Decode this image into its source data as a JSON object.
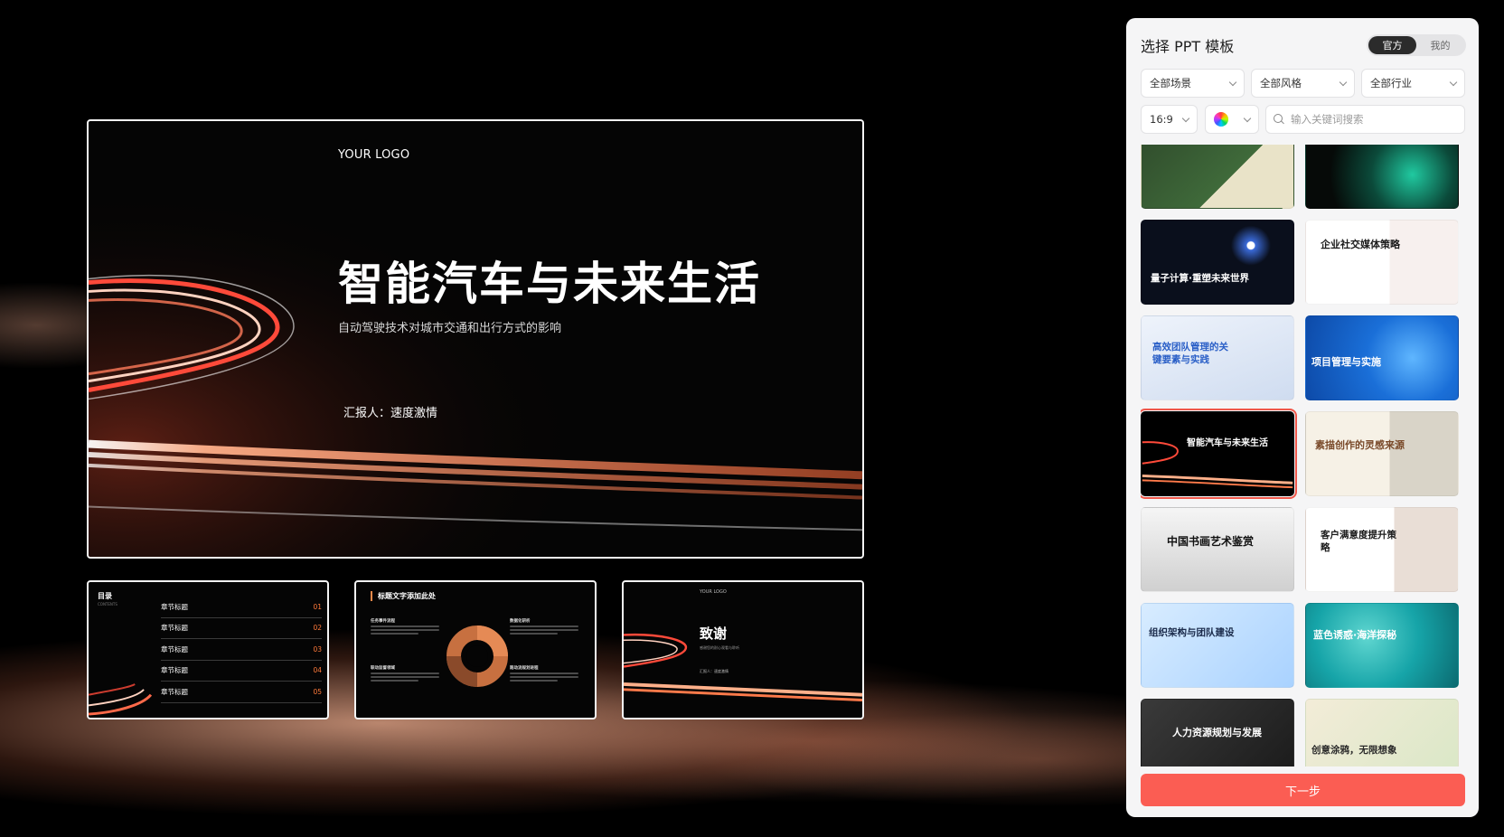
{
  "main_slide": {
    "logo": "YOUR LOGO",
    "title": "智能汽车与未来生活",
    "subtitle": "自动驾驶技术对城市交通和出行方式的影响",
    "reporter": "汇报人：速度激情"
  },
  "thumb_toc": {
    "title": "目录",
    "subtitle": "CONTENTS",
    "items": [
      {
        "label": "章节标题",
        "num": "01"
      },
      {
        "label": "章节标题",
        "num": "02"
      },
      {
        "label": "章节标题",
        "num": "03"
      },
      {
        "label": "章节标题",
        "num": "04"
      },
      {
        "label": "章节标题",
        "num": "05"
      }
    ]
  },
  "thumb_content": {
    "heading": "标题文字添加此处",
    "blocks": [
      "任务事件流程",
      "数据化研析",
      "联动监督领域",
      "路动流规划进程"
    ]
  },
  "thumb_thanks": {
    "logo": "YOUR LOGO",
    "title": "致谢",
    "subtitle": "感谢您的耐心观看与聆听",
    "reporter": "汇报人：速度激情"
  },
  "panel": {
    "title": "选择 PPT 模板",
    "tabs": [
      {
        "label": "官方",
        "active": true
      },
      {
        "label": "我的",
        "active": false
      }
    ],
    "filters": {
      "scene": "全部场景",
      "style": "全部风格",
      "industry": "全部行业",
      "ratio": "16:9"
    },
    "search_placeholder": "输入关键词搜索",
    "templates": [
      {
        "title": "",
        "bg": "#2f4a2b",
        "fg": "#ffffff"
      },
      {
        "title": "",
        "bg": "#0b1410",
        "fg": "#ffffff"
      },
      {
        "title": "量子计算·重塑未来世界",
        "bg": "#0a0f1c",
        "fg": "#ffffff"
      },
      {
        "title": "企业社交媒体策略",
        "bg": "#ffffff",
        "fg": "#1a1a1a"
      },
      {
        "title": "高效团队管理的关键要素与实践",
        "bg": "#dfe8f5",
        "fg": "#2a5fc7"
      },
      {
        "title": "项目管理与实施",
        "bg": "#1a6fd8",
        "fg": "#ffffff"
      },
      {
        "title": "智能汽车与未来生活",
        "bg": "#000000",
        "fg": "#ffffff",
        "selected": true
      },
      {
        "title": "素描创作的灵感来源",
        "bg": "#f3eee2",
        "fg": "#7a4a2a"
      },
      {
        "title": "中国书画艺术鉴赏",
        "bg": "#eeeeee",
        "fg": "#111111"
      },
      {
        "title": "客户满意度提升策略",
        "bg": "#ffffff",
        "fg": "#1a1a1a"
      },
      {
        "title": "组织架构与团队建设",
        "bg": "#cfe4fb",
        "fg": "#1a2a4a"
      },
      {
        "title": "蓝色诱惑·海洋探秘",
        "bg": "#16a4a8",
        "fg": "#ffffff"
      },
      {
        "title": "人力资源规划与发展",
        "bg": "#2a2a2a",
        "fg": "#ffffff"
      },
      {
        "title": "创意涂鸦，无限想象",
        "bg": "#efe6cf",
        "fg": "#2a2a2a"
      }
    ],
    "next_button": "下一步"
  }
}
